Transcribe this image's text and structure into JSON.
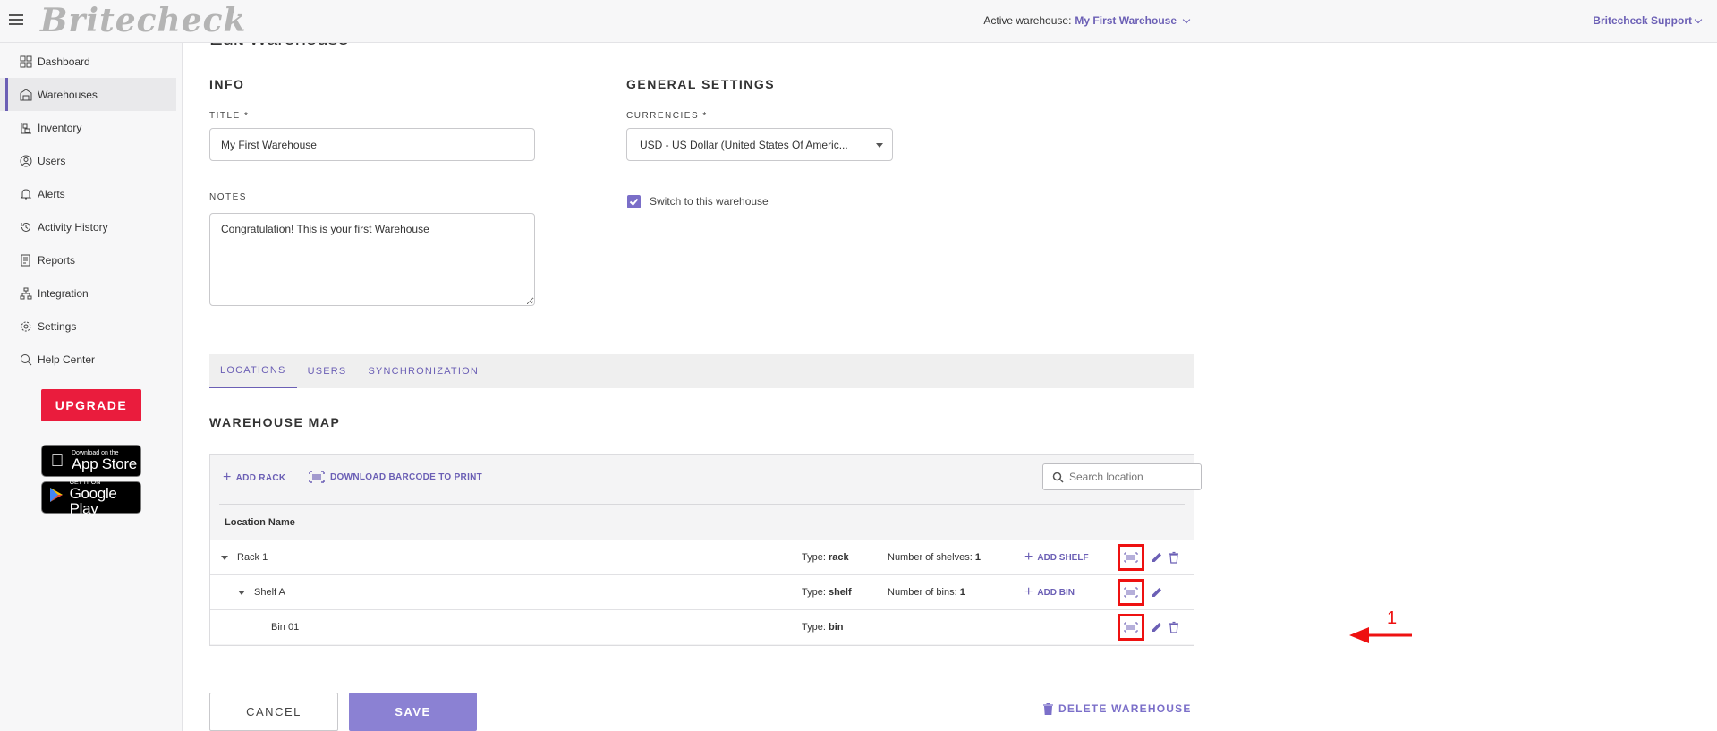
{
  "topbar": {
    "logo": "Britecheck",
    "active_label": "Active warehouse:",
    "active_value": "My First Warehouse",
    "support": "Britecheck Support"
  },
  "sidebar": {
    "items": [
      {
        "label": "Dashboard",
        "icon": "dashboard-icon"
      },
      {
        "label": "Warehouses",
        "icon": "warehouse-icon"
      },
      {
        "label": "Inventory",
        "icon": "inventory-icon"
      },
      {
        "label": "Users",
        "icon": "users-icon"
      },
      {
        "label": "Alerts",
        "icon": "bell-icon"
      },
      {
        "label": "Activity History",
        "icon": "history-icon"
      },
      {
        "label": "Reports",
        "icon": "reports-icon"
      },
      {
        "label": "Integration",
        "icon": "integration-icon"
      },
      {
        "label": "Settings",
        "icon": "gear-icon"
      },
      {
        "label": "Help Center",
        "icon": "help-icon"
      }
    ],
    "active_item": "Warehouses",
    "upgrade": "UPGRADE",
    "app_store_small": "Download on the",
    "app_store_big": "App Store",
    "google_small": "GET IT ON",
    "google_big": "Google Play"
  },
  "page": {
    "partial_title": "Edit Warehouse",
    "info_heading": "INFO",
    "general_heading": "GENERAL SETTINGS",
    "title_label": "TITLE *",
    "title_value": "My First Warehouse",
    "notes_label": "NOTES",
    "notes_value": "Congratulation! This is your first Warehouse",
    "currencies_label": "CURRENCIES *",
    "currency_value": "USD - US Dollar (United States Of Americ...",
    "switch_label": "Switch to this warehouse",
    "switch_checked": true
  },
  "tabs": [
    "LOCATIONS",
    "USERS",
    "SYNCHRONIZATION"
  ],
  "active_tab": "LOCATIONS",
  "map": {
    "heading": "WAREHOUSE MAP",
    "add_rack": "ADD RACK",
    "download_barcode": "DOWNLOAD BARCODE TO PRINT",
    "search_placeholder": "Search location",
    "column_header": "Location Name",
    "rows": [
      {
        "name": "Rack 1",
        "type_label": "Type:",
        "type": "rack",
        "count_label": "Number of shelves:",
        "count": "1",
        "add_label": "ADD SHELF"
      },
      {
        "name": "Shelf A",
        "type_label": "Type:",
        "type": "shelf",
        "count_label": "Number of bins:",
        "count": "1",
        "add_label": "ADD BIN"
      },
      {
        "name": "Bin 01",
        "type_label": "Type:",
        "type": "bin"
      }
    ]
  },
  "footer": {
    "cancel": "CANCEL",
    "save": "SAVE",
    "delete": "DELETE WAREHOUSE"
  },
  "annotation": {
    "number": "1",
    "color": "#e11111"
  },
  "colors": {
    "accent": "#6b5fb5",
    "upgrade": "#ea1c3d",
    "save": "#8b81d3"
  }
}
